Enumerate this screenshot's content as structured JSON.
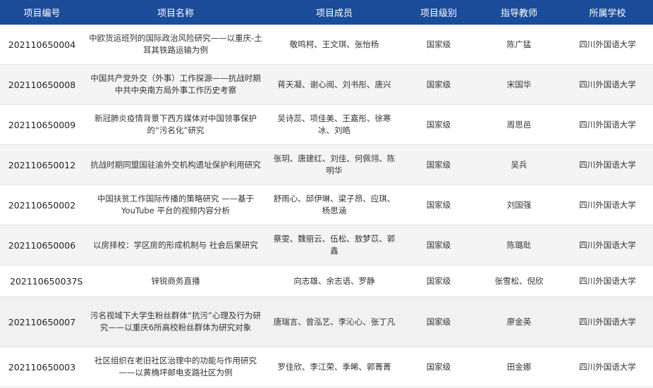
{
  "headers": [
    "项目编号",
    "项目名称",
    "项目成员",
    "项目级别",
    "指导教师",
    "所属学校"
  ],
  "rows": [
    {
      "id": "202110650004",
      "name": "中欧货运班列的国际政治风险研究——以重庆-土耳其铁路运输为例",
      "members": "敬鸣柯、王文琪、张怡杨",
      "level": "国家级",
      "teacher": "陈广猛",
      "school": "四川外国语大学"
    },
    {
      "id": "202110650008",
      "name": "中国共产党外交（外事）工作探源——抗战时期中共中央南方局外事工作历史考察",
      "members": "蒋天凝、谢心阅、刘书彤、唐兴",
      "level": "国家级",
      "teacher": "宋国华",
      "school": "四川外国语大学"
    },
    {
      "id": "202110650009",
      "name": "新冠肺炎疫情背景下西方媒体对中国领事保护的“污名化”研究",
      "members": "吴诗蕊、项佳美、王嘉彤、徐寒冰、刘皓",
      "level": "国家级",
      "teacher": "周思邑",
      "school": "四川外国语大学"
    },
    {
      "id": "202110650012",
      "name": "抗战时期同盟国驻渝外交机构遗址保护利用研究",
      "members": "张玥、唐建红、刘佳、何佩翎、陈明华",
      "level": "国家级",
      "teacher": "吴兵",
      "school": "四川外国语大学"
    },
    {
      "id": "202110650002",
      "name": "中国扶贫工作国际传播的策略研究 ——基于 YouTube 平台的视频内容分析",
      "members": "舒雨心、邱伊琳、梁子昂、应琪、杨思涵",
      "level": "国家级",
      "teacher": "刘国强",
      "school": "四川外国语大学"
    },
    {
      "id": "202110650006",
      "name": "以房择校：学区房的形成机制与 社会后果研究",
      "members": "蔡雯、魏丽云、伍松、敖梦苡、郭鑫",
      "level": "国家级",
      "teacher": "陈璐玭",
      "school": "四川外国语大学"
    },
    {
      "id": "202110650037S",
      "name": "锌锐商务直播",
      "members": "向志雄、余志语、罗静",
      "level": "国家级",
      "teacher": "张雪松、倪欣",
      "school": "四川外国语大学"
    },
    {
      "id": "202110650007",
      "name": "污名视域下大学生粉丝群体“抗污”心理及行为研究——以重庆6所高校粉丝群体为研究对象",
      "members": "唐瑞言、曾泓艺、李沁心、张丁凡",
      "level": "国家级",
      "teacher": "廖金英",
      "school": "四川外国语大学"
    },
    {
      "id": "202110650003",
      "name": "社区组织在老旧社区治理中的功能与作用研究——以黄桷坪邮电支路社区为例",
      "members": "罗佳欣、李江荣、季晞、郭菁菁",
      "level": "国家级",
      "teacher": "田金娜",
      "school": "四川外国语大学"
    }
  ]
}
